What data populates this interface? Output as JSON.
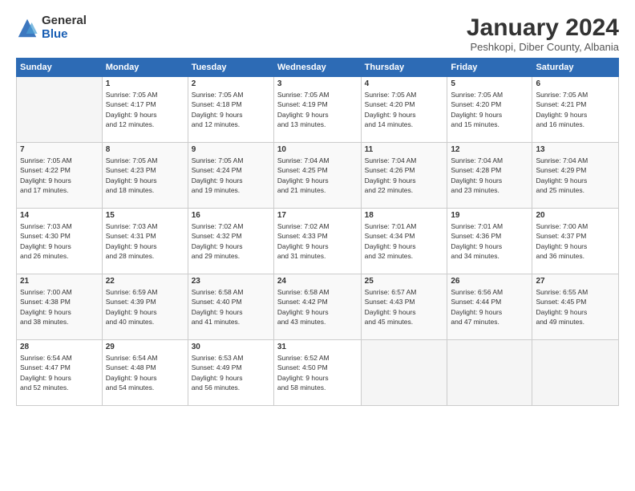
{
  "logo": {
    "general": "General",
    "blue": "Blue"
  },
  "title": "January 2024",
  "location": "Peshkopi, Diber County, Albania",
  "days_header": [
    "Sunday",
    "Monday",
    "Tuesday",
    "Wednesday",
    "Thursday",
    "Friday",
    "Saturday"
  ],
  "weeks": [
    [
      {
        "day": "",
        "info": ""
      },
      {
        "day": "1",
        "info": "Sunrise: 7:05 AM\nSunset: 4:17 PM\nDaylight: 9 hours\nand 12 minutes."
      },
      {
        "day": "2",
        "info": "Sunrise: 7:05 AM\nSunset: 4:18 PM\nDaylight: 9 hours\nand 12 minutes."
      },
      {
        "day": "3",
        "info": "Sunrise: 7:05 AM\nSunset: 4:19 PM\nDaylight: 9 hours\nand 13 minutes."
      },
      {
        "day": "4",
        "info": "Sunrise: 7:05 AM\nSunset: 4:20 PM\nDaylight: 9 hours\nand 14 minutes."
      },
      {
        "day": "5",
        "info": "Sunrise: 7:05 AM\nSunset: 4:20 PM\nDaylight: 9 hours\nand 15 minutes."
      },
      {
        "day": "6",
        "info": "Sunrise: 7:05 AM\nSunset: 4:21 PM\nDaylight: 9 hours\nand 16 minutes."
      }
    ],
    [
      {
        "day": "7",
        "info": "Sunrise: 7:05 AM\nSunset: 4:22 PM\nDaylight: 9 hours\nand 17 minutes."
      },
      {
        "day": "8",
        "info": "Sunrise: 7:05 AM\nSunset: 4:23 PM\nDaylight: 9 hours\nand 18 minutes."
      },
      {
        "day": "9",
        "info": "Sunrise: 7:05 AM\nSunset: 4:24 PM\nDaylight: 9 hours\nand 19 minutes."
      },
      {
        "day": "10",
        "info": "Sunrise: 7:04 AM\nSunset: 4:25 PM\nDaylight: 9 hours\nand 21 minutes."
      },
      {
        "day": "11",
        "info": "Sunrise: 7:04 AM\nSunset: 4:26 PM\nDaylight: 9 hours\nand 22 minutes."
      },
      {
        "day": "12",
        "info": "Sunrise: 7:04 AM\nSunset: 4:28 PM\nDaylight: 9 hours\nand 23 minutes."
      },
      {
        "day": "13",
        "info": "Sunrise: 7:04 AM\nSunset: 4:29 PM\nDaylight: 9 hours\nand 25 minutes."
      }
    ],
    [
      {
        "day": "14",
        "info": "Sunrise: 7:03 AM\nSunset: 4:30 PM\nDaylight: 9 hours\nand 26 minutes."
      },
      {
        "day": "15",
        "info": "Sunrise: 7:03 AM\nSunset: 4:31 PM\nDaylight: 9 hours\nand 28 minutes."
      },
      {
        "day": "16",
        "info": "Sunrise: 7:02 AM\nSunset: 4:32 PM\nDaylight: 9 hours\nand 29 minutes."
      },
      {
        "day": "17",
        "info": "Sunrise: 7:02 AM\nSunset: 4:33 PM\nDaylight: 9 hours\nand 31 minutes."
      },
      {
        "day": "18",
        "info": "Sunrise: 7:01 AM\nSunset: 4:34 PM\nDaylight: 9 hours\nand 32 minutes."
      },
      {
        "day": "19",
        "info": "Sunrise: 7:01 AM\nSunset: 4:36 PM\nDaylight: 9 hours\nand 34 minutes."
      },
      {
        "day": "20",
        "info": "Sunrise: 7:00 AM\nSunset: 4:37 PM\nDaylight: 9 hours\nand 36 minutes."
      }
    ],
    [
      {
        "day": "21",
        "info": "Sunrise: 7:00 AM\nSunset: 4:38 PM\nDaylight: 9 hours\nand 38 minutes."
      },
      {
        "day": "22",
        "info": "Sunrise: 6:59 AM\nSunset: 4:39 PM\nDaylight: 9 hours\nand 40 minutes."
      },
      {
        "day": "23",
        "info": "Sunrise: 6:58 AM\nSunset: 4:40 PM\nDaylight: 9 hours\nand 41 minutes."
      },
      {
        "day": "24",
        "info": "Sunrise: 6:58 AM\nSunset: 4:42 PM\nDaylight: 9 hours\nand 43 minutes."
      },
      {
        "day": "25",
        "info": "Sunrise: 6:57 AM\nSunset: 4:43 PM\nDaylight: 9 hours\nand 45 minutes."
      },
      {
        "day": "26",
        "info": "Sunrise: 6:56 AM\nSunset: 4:44 PM\nDaylight: 9 hours\nand 47 minutes."
      },
      {
        "day": "27",
        "info": "Sunrise: 6:55 AM\nSunset: 4:45 PM\nDaylight: 9 hours\nand 49 minutes."
      }
    ],
    [
      {
        "day": "28",
        "info": "Sunrise: 6:54 AM\nSunset: 4:47 PM\nDaylight: 9 hours\nand 52 minutes."
      },
      {
        "day": "29",
        "info": "Sunrise: 6:54 AM\nSunset: 4:48 PM\nDaylight: 9 hours\nand 54 minutes."
      },
      {
        "day": "30",
        "info": "Sunrise: 6:53 AM\nSunset: 4:49 PM\nDaylight: 9 hours\nand 56 minutes."
      },
      {
        "day": "31",
        "info": "Sunrise: 6:52 AM\nSunset: 4:50 PM\nDaylight: 9 hours\nand 58 minutes."
      },
      {
        "day": "",
        "info": ""
      },
      {
        "day": "",
        "info": ""
      },
      {
        "day": "",
        "info": ""
      }
    ]
  ]
}
